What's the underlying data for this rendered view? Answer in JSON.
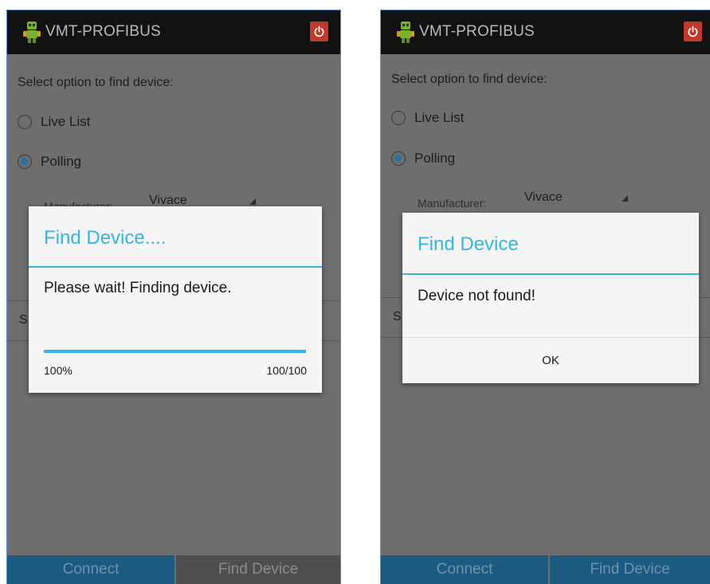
{
  "app": {
    "title": "VMT-PROFIBUS",
    "colors": {
      "action_bar": "#121212",
      "accent": "#33b5e5",
      "power": "#c0392b",
      "bottom_bar": "#1d5a80"
    },
    "icons": {
      "app": "robot-logo-icon",
      "power": "power-icon"
    }
  },
  "screens": [
    {
      "prompt": "Select option to find device:",
      "options": [
        {
          "label": "Live List",
          "checked": false
        },
        {
          "label": "Polling",
          "checked": true
        }
      ],
      "manufacturer_label": "Manufacturer:",
      "manufacturer_value": "Vivace",
      "s_fragment": "S",
      "bottom": {
        "connect": "Connect",
        "find": "Find Device"
      },
      "dialog": {
        "title": "Find Device....",
        "message": "Please wait! Finding device.",
        "progress_percent": "100%",
        "progress_count": "100/100",
        "progress_fraction": 1.0
      }
    },
    {
      "prompt": "Select option to find device:",
      "options": [
        {
          "label": "Live List",
          "checked": false
        },
        {
          "label": "Polling",
          "checked": true
        }
      ],
      "manufacturer_label": "Manufacturer:",
      "manufacturer_value": "Vivace",
      "s_fragment": "S",
      "bottom": {
        "connect": "Connect",
        "find": "Find Device"
      },
      "dialog": {
        "title": "Find Device",
        "message": "Device not found!",
        "ok_label": "OK"
      }
    }
  ]
}
